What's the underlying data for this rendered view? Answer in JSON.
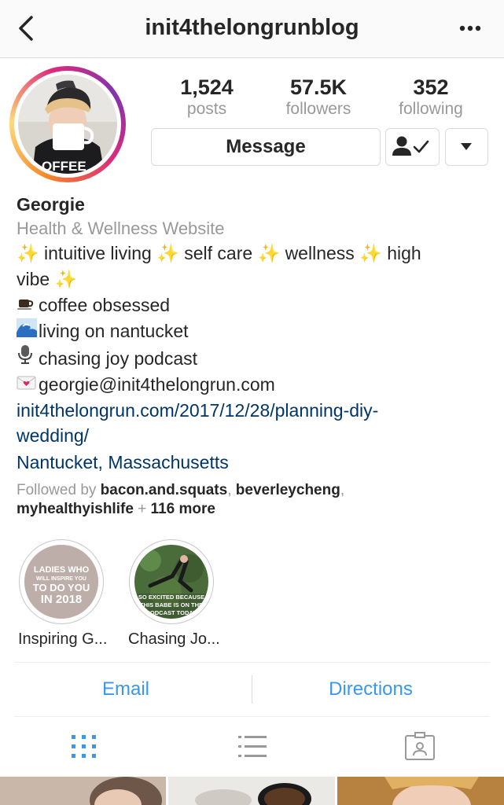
{
  "header": {
    "title": "init4thelongrunblog",
    "back_icon": "chevron-left-icon",
    "more_icon": "more-horizontal-icon"
  },
  "profile": {
    "stats": [
      {
        "value": "1,524",
        "label": "posts"
      },
      {
        "value": "57.5K",
        "label": "followers"
      },
      {
        "value": "352",
        "label": "following"
      }
    ],
    "message_label": "Message",
    "following_icon": "person-check-icon",
    "dropdown_icon": "caret-down-icon",
    "ring_colors": [
      "#f58529",
      "#dd2a7b",
      "#8134af"
    ]
  },
  "bio": {
    "name": "Georgie",
    "category": "Health & Wellness Website",
    "tagline_1": "✨ intuitive living ✨ self care ✨ wellness ✨ high",
    "tagline_2": "vibe ✨",
    "line_coffee": "coffee obsessed",
    "line_nantucket": "living on nantucket",
    "line_podcast": "chasing joy podcast",
    "line_email": "georgie@init4thelongrun.com",
    "icons": {
      "coffee": "coffee-cup-icon",
      "wave": "wave-icon",
      "podcast": "microphone-icon",
      "email": "love-letter-icon"
    },
    "link_1": "init4thelongrun.com/2017/12/28/planning-diy-",
    "link_2": "wedding/",
    "location": "Nantucket, Massachusetts",
    "followed_by_prefix": "Followed by",
    "followed_by_user_1": "bacon.and.squats",
    "followed_by_user_2": "beverleycheng",
    "followed_by_user_3": "myhealthyishlife",
    "followed_by_more": "116 more"
  },
  "highlights": [
    {
      "label": "Inspiring G...",
      "cover_text_1": "LADIES WHO",
      "cover_text_2": "WILL INSPIRE YOU",
      "cover_text_3": "TO DO YOU",
      "cover_text_4": "IN 2018"
    },
    {
      "label": "Chasing Jo...",
      "cover_text_1": "SO EXCITED BECAUSE",
      "cover_text_2": "THIS BABE IS ON THE",
      "cover_text_3": "PODCAST TODAY"
    }
  ],
  "actions": {
    "email_label": "Email",
    "directions_label": "Directions"
  },
  "tabs": [
    {
      "icon": "grid-icon",
      "active": true
    },
    {
      "icon": "list-icon",
      "active": false
    },
    {
      "icon": "tagged-icon",
      "active": false
    }
  ],
  "colors": {
    "link": "#003569",
    "action": "#3897f0",
    "muted": "#999999",
    "text": "#262626"
  }
}
